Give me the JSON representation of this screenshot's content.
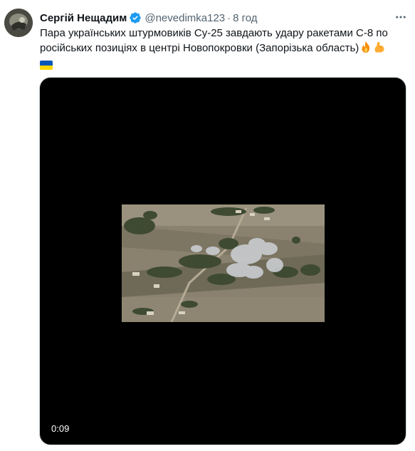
{
  "tweet": {
    "author": {
      "display_name": "Сергій Нещадим",
      "handle": "@nevedimka123",
      "separator": "·",
      "time": "8 год",
      "verified": true
    },
    "text_lines": [
      "Пара українських штурмовиків Су-25 завдають удару ракетами С-8 по",
      "російських позиціях в центрі Новопокровки (Запорізька область)"
    ],
    "emojis": [
      "fire-emoji",
      "flexed-biceps-emoji",
      "ukraine-flag-emoji"
    ],
    "video": {
      "timestamp": "0:09"
    }
  },
  "colors": {
    "text_primary": "#0f1419",
    "text_secondary": "#536471",
    "verified_blue": "#1d9bf0",
    "video_background": "#000000",
    "flag_blue": "#0057b7",
    "flag_yellow": "#ffd700"
  }
}
